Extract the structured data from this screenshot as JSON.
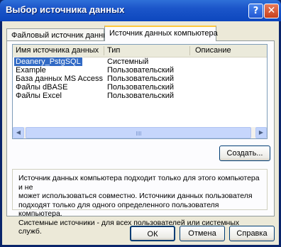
{
  "window": {
    "title": "Выбор источника данных",
    "help_glyph": "?",
    "close_glyph": "✕"
  },
  "tabs": [
    {
      "label": "Файловый источник данных"
    },
    {
      "label": "Источник данных компьютера"
    }
  ],
  "list": {
    "columns": [
      "Имя источника данных",
      "Тип",
      "Описание"
    ],
    "rows": [
      {
        "name": "Deanery_PstgSQL",
        "type": "Системный",
        "description": ""
      },
      {
        "name": "Example",
        "type": "Пользовательский",
        "description": ""
      },
      {
        "name": "База данных MS Access",
        "type": "Пользовательский",
        "description": ""
      },
      {
        "name": "Файлы dBASE",
        "type": "Пользовательский",
        "description": ""
      },
      {
        "name": "Файлы Excel",
        "type": "Пользовательский",
        "description": ""
      }
    ],
    "selected_row": 0
  },
  "buttons": {
    "create": "Создать...",
    "ok": "ОК",
    "cancel": "Отмена",
    "help": "Справка"
  },
  "info": {
    "line1": "Источник данных компьютера подходит только для этого компьютера и не",
    "line2": "может использоваться совместно.  Источники данных пользователя",
    "line3": "подходят только для одного определенного пользователя компьютера.",
    "line4": "Системные источники - для всех пользователей или системных служб."
  },
  "colors": {
    "title_bar": "#1b55c9",
    "selection": "#316ac5",
    "dialog_face": "#ece9d8"
  }
}
